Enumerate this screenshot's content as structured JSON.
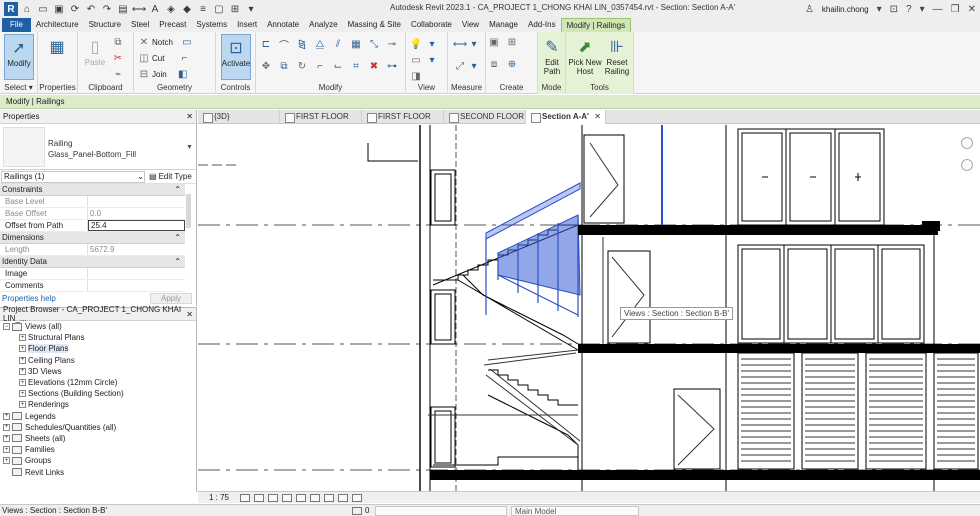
{
  "titlebar": {
    "logo": "R",
    "title": "Autodesk Revit 2023.1 - CA_PROJECT 1_CHONG KHAI LIN_0357454.rvt - Section: Section A-A'",
    "user": "khailin.chong",
    "help": "?"
  },
  "ribbon_tabs": [
    "Architecture",
    "Structure",
    "Steel",
    "Precast",
    "Systems",
    "Insert",
    "Annotate",
    "Analyze",
    "Massing & Site",
    "Collaborate",
    "View",
    "Manage",
    "Add-Ins"
  ],
  "file_tab": "File",
  "context_tab": "Modify | Railings",
  "ribbon": {
    "select": {
      "modify": "Modify",
      "label": "Select ▾"
    },
    "properties": {
      "btn": "Properties",
      "label": "Properties"
    },
    "clipboard": {
      "paste": "Paste",
      "label": "Clipboard"
    },
    "geometry": {
      "notch": "Notch",
      "cut": "Cut",
      "join": "Join",
      "label": "Geometry"
    },
    "controls": {
      "activate": "Activate",
      "label": "Controls"
    },
    "modify": {
      "label": "Modify"
    },
    "view": {
      "label": "View"
    },
    "measure": {
      "label": "Measure"
    },
    "create": {
      "label": "Create"
    },
    "mode": {
      "edit_path": "Edit Path",
      "label": "Mode"
    },
    "tools": {
      "pick_new_host": "Pick New Host",
      "reset_railing": "Reset Railing",
      "label": "Tools"
    }
  },
  "options_bar": "Modify | Railings",
  "properties": {
    "title": "Properties",
    "type_family": "Railing",
    "type_name": "Glass_Panel-Bottom_Fill",
    "instance_filter": "Railings (1)",
    "edit_type": "Edit Type",
    "groups": [
      {
        "name": "Constraints",
        "rows": [
          {
            "key": "Base Level",
            "value": "",
            "active": false
          },
          {
            "key": "Base Offset",
            "value": "0.0",
            "active": false
          },
          {
            "key": "Offset from Path",
            "value": "25.4",
            "active": true
          }
        ]
      },
      {
        "name": "Dimensions",
        "rows": [
          {
            "key": "Length",
            "value": "5672.9",
            "active": false
          }
        ]
      },
      {
        "name": "Identity Data",
        "rows": [
          {
            "key": "Image",
            "value": "",
            "active": true
          },
          {
            "key": "Comments",
            "value": "",
            "active": true
          }
        ]
      }
    ],
    "help_link": "Properties help",
    "apply": "Apply"
  },
  "browser": {
    "title": "Project Browser - CA_PROJECT 1_CHONG KHAI LIN_...",
    "nodes": [
      {
        "label": "Views (all)",
        "level": 0,
        "toggle": "−"
      },
      {
        "label": "Structural Plans",
        "level": 1,
        "toggle": "+"
      },
      {
        "label": "Floor Plans",
        "level": 1,
        "toggle": "+",
        "selected": true
      },
      {
        "label": "Ceiling Plans",
        "level": 1,
        "toggle": "+"
      },
      {
        "label": "3D Views",
        "level": 1,
        "toggle": "+"
      },
      {
        "label": "Elevations (12mm Circle)",
        "level": 1,
        "toggle": "+"
      },
      {
        "label": "Sections (Building Section)",
        "level": 1,
        "toggle": "+"
      },
      {
        "label": "Renderings",
        "level": 1,
        "toggle": "+"
      },
      {
        "label": "Legends",
        "level": 0,
        "toggle": "+"
      },
      {
        "label": "Schedules/Quantities (all)",
        "level": 0,
        "toggle": "+"
      },
      {
        "label": "Sheets (all)",
        "level": 0,
        "toggle": "+"
      },
      {
        "label": "Families",
        "level": 0,
        "toggle": "+"
      },
      {
        "label": "Groups",
        "level": 0,
        "toggle": "+"
      },
      {
        "label": "Revit Links",
        "level": 0,
        "toggle": ""
      }
    ]
  },
  "view_tabs": [
    {
      "label": "{3D}",
      "active": false
    },
    {
      "label": "FIRST FLOOR",
      "active": false
    },
    {
      "label": "FIRST FLOOR",
      "active": false
    },
    {
      "label": "SECOND FLOOR",
      "active": false
    },
    {
      "label": "Section A-A'",
      "active": true
    }
  ],
  "canvas": {
    "tooltip": "Views : Section : Section B-B'"
  },
  "view_control_bar": {
    "scale": "1 : 75"
  },
  "status_bar": {
    "message": "Views : Section : Section B-B'",
    "workset": "0",
    "model": "Main Model"
  },
  "colors": {
    "file_tab": "#1f5fa6",
    "context_tab": "#cfe7b6",
    "railing_highlight": "#3b5fd6",
    "link": "#1a63b0"
  }
}
